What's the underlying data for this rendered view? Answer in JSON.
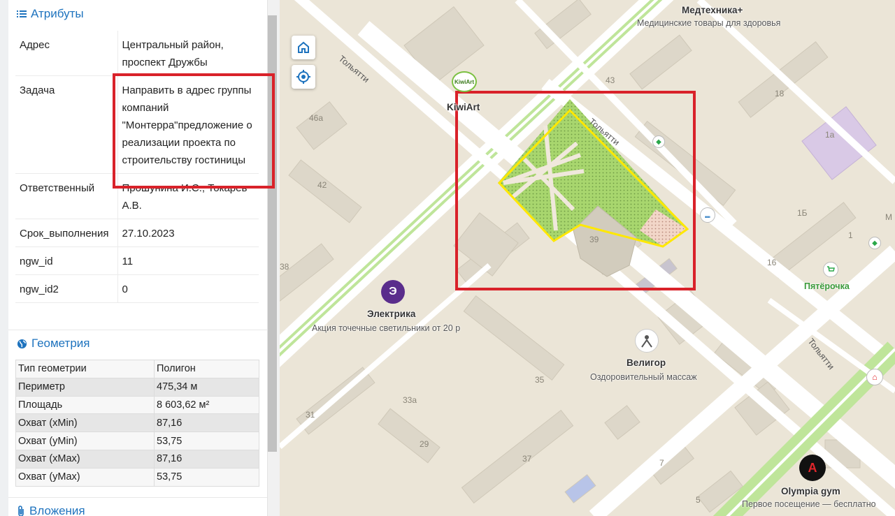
{
  "attributes": {
    "title": "Атрибуты",
    "rows": [
      {
        "key": "Адрес",
        "value": "Центральный район, проспект Дружбы"
      },
      {
        "key": "Задача",
        "value": "Направить в адрес группы компаний \"Монтерра\"предложение о реализации проекта по строительству гостиницы"
      },
      {
        "key": "Ответственный",
        "value": "Прошунина И.С., Токарев А.В."
      },
      {
        "key": "Срок_выполнения",
        "value": "27.10.2023"
      },
      {
        "key": "ngw_id",
        "value": "11"
      },
      {
        "key": "ngw_id2",
        "value": "0"
      }
    ]
  },
  "geometry": {
    "title": "Геометрия",
    "rows": [
      {
        "key": "Тип геометрии",
        "value": "Полигон"
      },
      {
        "key": "Периметр",
        "value": "475,34 м"
      },
      {
        "key": "Площадь",
        "value": "8 603,62 м²"
      },
      {
        "key": "Охват (xMin)",
        "value": "87,16"
      },
      {
        "key": "Охват (yMin)",
        "value": "53,75"
      },
      {
        "key": "Охват (xMax)",
        "value": "87,16"
      },
      {
        "key": "Охват (yMax)",
        "value": "53,75"
      }
    ]
  },
  "attachments": {
    "title": "Вложения"
  },
  "map": {
    "controls": {
      "home_icon": "home-icon",
      "locate_icon": "locate-icon"
    },
    "pois": {
      "medtehnika": {
        "name": "Медтехника+",
        "desc": "Медицинские товары для здоровья"
      },
      "kiwiart": {
        "name": "KiwiArt",
        "logo": "KiwiArt"
      },
      "elektrika": {
        "name": "Электрика",
        "desc": "Акция точечные светильники от 20 р"
      },
      "veligor": {
        "name": "Велигор",
        "desc": "Оздоровительный массаж"
      },
      "olympia": {
        "name": "Olympia gym",
        "desc": "Первое посещение — бесплатно"
      },
      "pyaterochka": {
        "name": "Пятёрочка"
      }
    },
    "streets": [
      "Тольятти",
      "Тольятти",
      "Тольятти"
    ],
    "building_numbers": [
      "43",
      "18",
      "1а",
      "46а",
      "42",
      "39",
      "1Б",
      "1",
      "16",
      "38",
      "35",
      "33а",
      "31",
      "29",
      "37",
      "7",
      "5",
      "М"
    ],
    "colors": {
      "background": "#ebe5d7",
      "road": "#ffffff",
      "green": "#bfe59a",
      "building": "#dcd6c8",
      "polygon_outline": "#ffe800",
      "highlight": "#d9222a",
      "accent": "#1e73be"
    }
  }
}
